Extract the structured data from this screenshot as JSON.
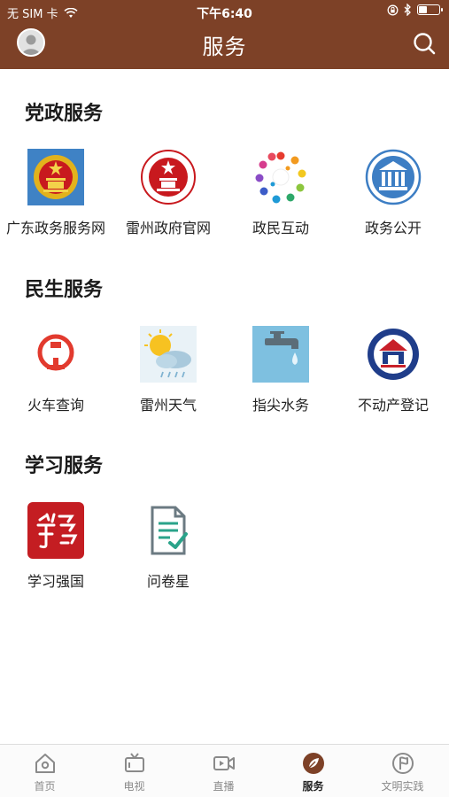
{
  "status_bar": {
    "carrier": "无 SIM 卡",
    "time": "下午6:40"
  },
  "header": {
    "title": "服务"
  },
  "sections": [
    {
      "title": "党政服务",
      "items": [
        {
          "label": "广东政务服务网",
          "icon": "national-emblem-icon"
        },
        {
          "label": "雷州政府官网",
          "icon": "government-emblem-icon"
        },
        {
          "label": "政民互动",
          "icon": "people-circle-icon"
        },
        {
          "label": "政务公开",
          "icon": "government-building-icon"
        }
      ]
    },
    {
      "title": "民生服务",
      "items": [
        {
          "label": "火车查询",
          "icon": "railway-logo-icon"
        },
        {
          "label": "雷州天气",
          "icon": "weather-sun-cloud-icon"
        },
        {
          "label": "指尖水务",
          "icon": "water-tap-icon"
        },
        {
          "label": "不动产登记",
          "icon": "real-estate-seal-icon"
        }
      ]
    },
    {
      "title": "学习服务",
      "items": [
        {
          "label": "学习强国",
          "icon": "xuexi-qiangguo-icon"
        },
        {
          "label": "问卷星",
          "icon": "questionnaire-icon"
        }
      ]
    }
  ],
  "tabbar": {
    "tabs": [
      {
        "label": "首页",
        "icon": "home-icon"
      },
      {
        "label": "电视",
        "icon": "tv-icon"
      },
      {
        "label": "直播",
        "icon": "live-video-icon"
      },
      {
        "label": "服务",
        "icon": "compass-leaf-icon",
        "active": true
      },
      {
        "label": "文明实践",
        "icon": "flag-icon"
      }
    ]
  },
  "colors": {
    "header_bg": "#7d4127",
    "active_tab": "#7d4127",
    "inactive_tab": "#8a8a8a"
  }
}
